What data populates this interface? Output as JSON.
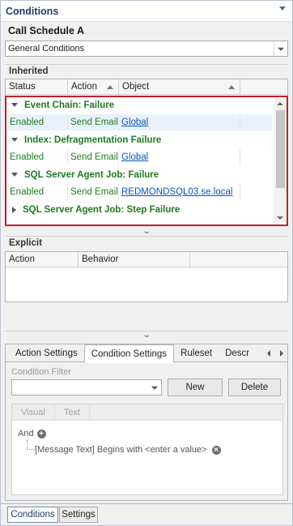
{
  "panel": {
    "title": "Conditions"
  },
  "schedule": {
    "name": "Call Schedule A"
  },
  "category": {
    "value": "General Conditions"
  },
  "inherited": {
    "title": "Inherited",
    "columns": [
      "Status",
      "Action",
      "Object"
    ],
    "groups": [
      {
        "name": "Event Chain: Failure",
        "expanded": true,
        "row": {
          "status": "Enabled",
          "action": "Send Email",
          "object": "Global"
        }
      },
      {
        "name": "Index: Defragmentation Failure",
        "expanded": true,
        "row": {
          "status": "Enabled",
          "action": "Send Email",
          "object": "Global"
        }
      },
      {
        "name": "SQL Server Agent Job: Failure",
        "expanded": true,
        "row": {
          "status": "Enabled",
          "action": "Send Email",
          "object": "REDMONDSQL03.se.local"
        }
      },
      {
        "name": "SQL Server Agent Job: Step Failure",
        "expanded": false
      }
    ]
  },
  "explicit": {
    "title": "Explicit",
    "columns": [
      "Action",
      "Behavior"
    ]
  },
  "settings_tabs": {
    "tabs": [
      "Action Settings",
      "Condition Settings",
      "Ruleset",
      "Descripti"
    ],
    "active": "Condition Settings"
  },
  "condition_filter": {
    "label": "Condition Filter",
    "value": "",
    "new_label": "New",
    "delete_label": "Delete"
  },
  "editor": {
    "tabs": [
      "Visual",
      "Text"
    ],
    "and_label": "And",
    "condition_text": "[Message Text] Begins with <enter a value>"
  },
  "bottom_tabs": {
    "conditions": "Conditions",
    "settings": "Settings"
  },
  "colors": {
    "accent": "#1f3c68",
    "status_green": "#1e7a1e",
    "link_blue": "#0e55b5",
    "highlight_red": "#c0202f"
  }
}
